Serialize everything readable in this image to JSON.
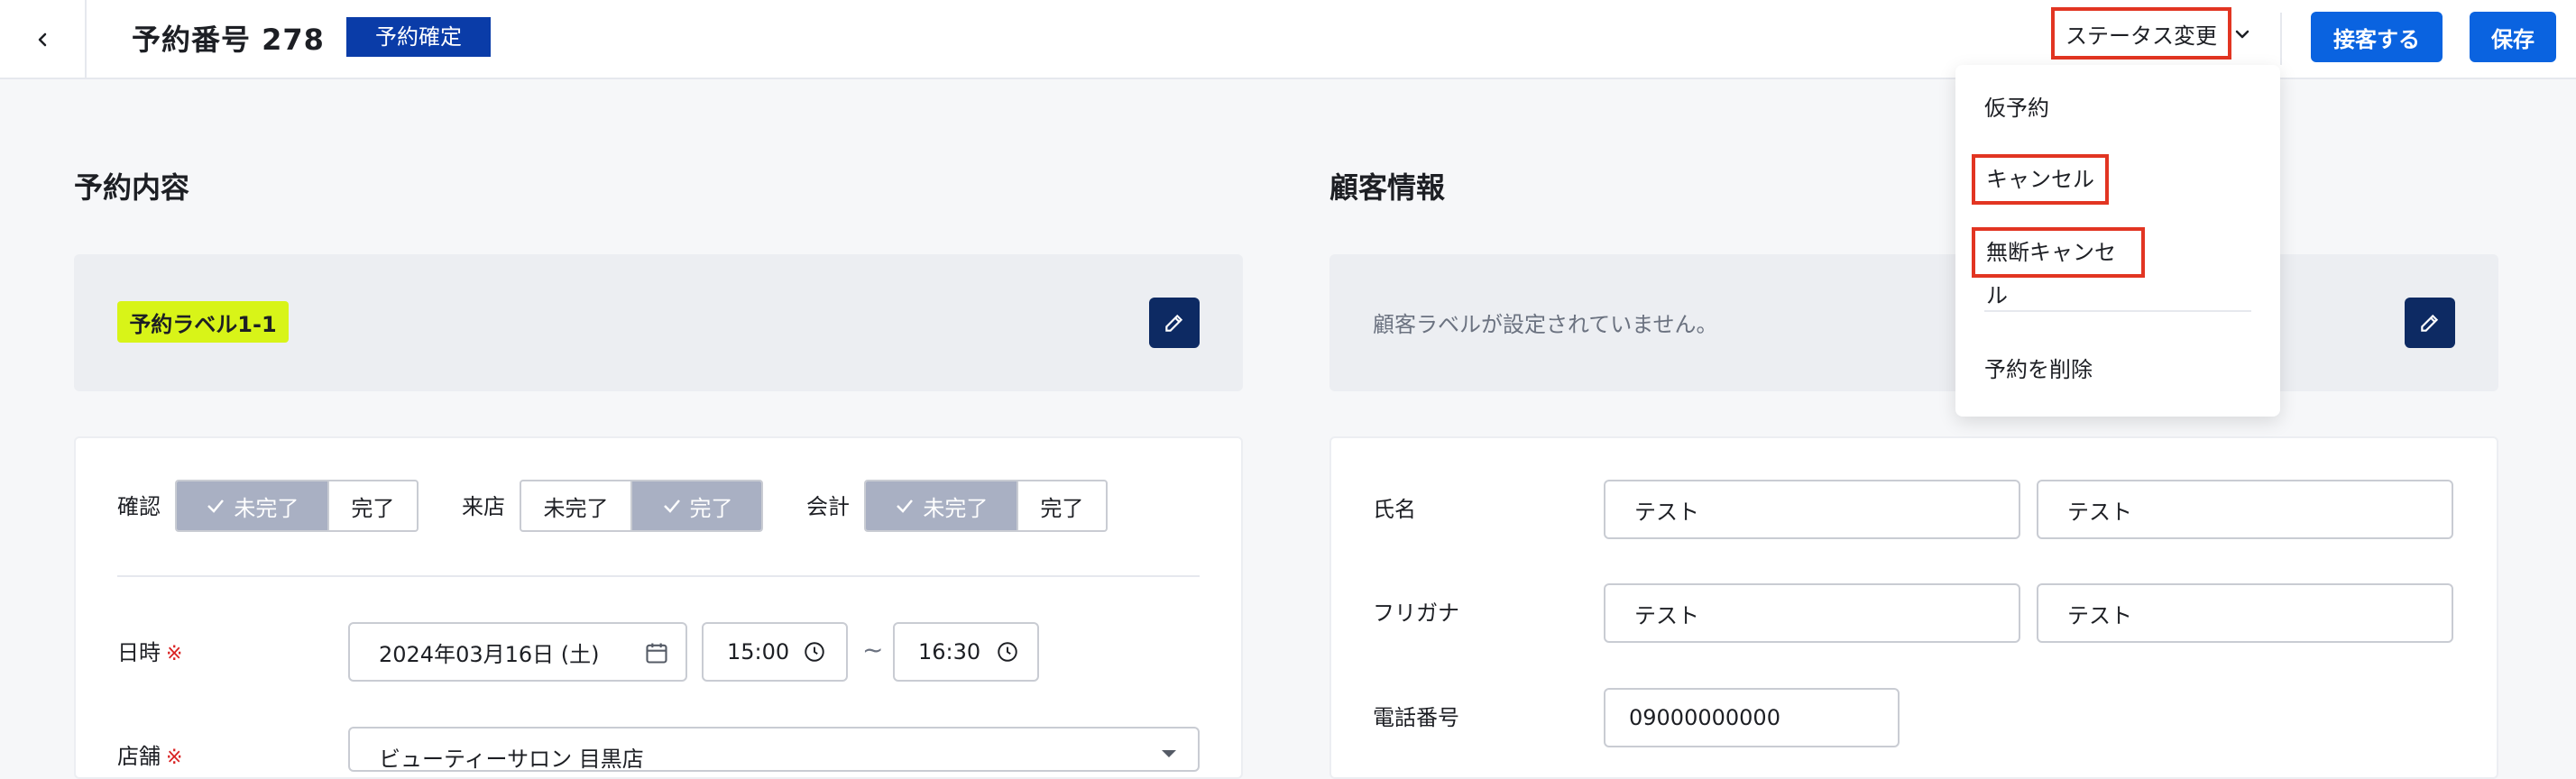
{
  "header": {
    "title": "予約番号 278",
    "status_badge": "予約確定",
    "status_change_label": "ステータス変更",
    "serve_button": "接客する",
    "save_button": "保存"
  },
  "dropdown": {
    "items": [
      "仮予約",
      "キャンセル",
      "無断キャンセル",
      "予約を削除"
    ]
  },
  "reservation": {
    "section_title": "予約内容",
    "label_chip": "予約ラベル1-1",
    "status_groups": [
      {
        "label": "確認",
        "options": [
          "未完了",
          "完了"
        ],
        "active_index": 0
      },
      {
        "label": "来店",
        "options": [
          "未完了",
          "完了"
        ],
        "active_index": 1
      },
      {
        "label": "会計",
        "options": [
          "未完了",
          "完了"
        ],
        "active_index": 0
      }
    ],
    "datetime_label": "日時",
    "required_mark": "※",
    "date_value": "2024年03月16日 (土)",
    "start_time": "15:00",
    "tilde": "~",
    "end_time": "16:30",
    "store_label": "店舗",
    "store_value": "ビューティーサロン 目黒店"
  },
  "customer": {
    "section_title": "顧客情報",
    "empty_label_text": "顧客ラベルが設定されていません。",
    "name_label": "氏名",
    "name_last": "テスト",
    "name_first": "テスト",
    "kana_label": "フリガナ",
    "kana_last": "テスト",
    "kana_first": "テスト",
    "phone_label": "電話番号",
    "phone_value": "09000000000"
  },
  "colors": {
    "accent_blue": "#0a63e0",
    "badge_blue": "#0a3ca8",
    "label_chip": "#d8f418",
    "edit_button": "#0d2a63",
    "highlight_red": "#e23522",
    "segment_active": "#a9b0c3"
  },
  "icons": {
    "back": "chevron-left-icon",
    "status_dropdown": "chevron-down-icon",
    "edit": "pencil-icon",
    "calendar": "calendar-icon",
    "clock": "clock-icon",
    "check": "check-icon",
    "select_arrow": "caret-down-icon"
  }
}
